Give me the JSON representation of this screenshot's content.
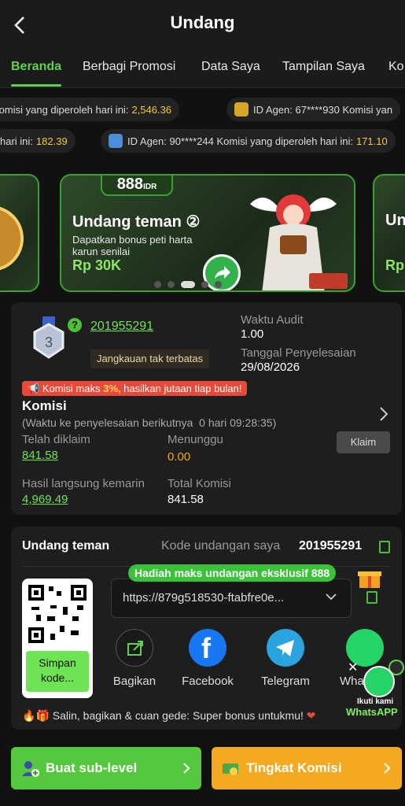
{
  "header": {
    "title": "Undang"
  },
  "tabs": [
    "Beranda",
    "Berbagi Promosi",
    "Data Saya",
    "Tampilan Saya",
    "Ko"
  ],
  "ticker1": {
    "a_label": "Komisi yang diperoleh hari ini:",
    "a_value": "2,546.36",
    "b_label": "ID Agen:",
    "b_id": "67****930",
    "b_tail": "Komisi yan"
  },
  "ticker2": {
    "a_label": "hari ini:",
    "a_value": "182.39",
    "b_label": "ID Agen:",
    "b_id": "90****244",
    "b_tail": "Komisi yang diperoleh hari ini:",
    "b_value": "171.10"
  },
  "banner": {
    "brand": "888",
    "brand_suffix": "IDR",
    "title": "Undang teman",
    "title_num": "②",
    "subtitle": "Dapatkan bonus peti harta karun senilai",
    "amount": "Rp 30K",
    "right_title": "Un",
    "right_amount": "Rp"
  },
  "agent": {
    "level": "3",
    "id": "201955291",
    "range": "Jangkauan tak terbatas",
    "audit_label": "Waktu Audit",
    "audit_value": "1.00",
    "finish_label": "Tanggal Penyelesaian",
    "finish_value": "29/08/2026",
    "promo_prefix": "Komisi maks",
    "promo_pct": "3%,",
    "promo_suffix": "hasilkan jutaan tiap bulan!",
    "komisi_title": "Komisi",
    "next_label": "(Waktu ke penyelesaian berikutnya",
    "next_value": "0 hari 09:28:35)",
    "claimed_label": "Telah diklaim",
    "claimed_value": "841.58",
    "pending_label": "Menunggu",
    "pending_value": "0.00",
    "claim_button": "Klaim",
    "yesterday_label": "Hasil langsung kemarin",
    "yesterday_value": "4,969.49",
    "total_label": "Total Komisi",
    "total_value": "841.58"
  },
  "invite": {
    "title": "Undang teman",
    "code_label": "Kode undangan saya",
    "code_value": "201955291",
    "exclusive": "Hadiah maks undangan eksklusif 888",
    "url": "https://879g518530-ftabfre0e...",
    "qr_save": "Simpan kode...",
    "share_items": [
      {
        "label": "Bagikan",
        "icon": "share-icon"
      },
      {
        "label": "Facebook",
        "icon": "facebook-icon"
      },
      {
        "label": "Telegram",
        "icon": "telegram-icon"
      },
      {
        "label": "Wha",
        "icon": "whatsapp-icon"
      }
    ],
    "float_label_1": "Ikuti kami",
    "float_label_2": "WhatsAPP",
    "bonus_text": "Salin, bagikan & cuan gede: Super bonus untukmu!"
  },
  "actions": {
    "sub_level": "Buat sub-level",
    "tingkat": "Tingkat Komisi"
  },
  "colors": {
    "green": "#5fd14a",
    "gold": "#f0c93a",
    "orange": "#f3aa22",
    "red": "#e64a3b"
  }
}
